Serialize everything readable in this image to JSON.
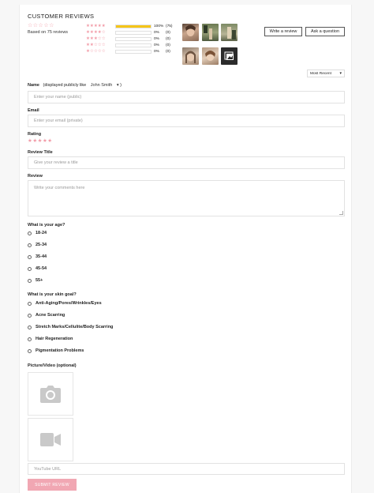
{
  "header": {
    "title": "CUSTOMER REVIEWS",
    "summary_stars": "☆☆☆☆☆",
    "based_on": "Based on 75 reviews"
  },
  "histogram": [
    {
      "stars": "★★★★★",
      "percent": 100,
      "pct_label": "100%",
      "count": "(75)"
    },
    {
      "stars": "★★★★☆",
      "percent": 0,
      "pct_label": "0%",
      "count": "(0)"
    },
    {
      "stars": "★★★☆☆",
      "percent": 0,
      "pct_label": "0%",
      "count": "(0)"
    },
    {
      "stars": "★★☆☆☆",
      "percent": 0,
      "pct_label": "0%",
      "count": "(0)"
    },
    {
      "stars": "★☆☆☆☆",
      "percent": 0,
      "pct_label": "0%",
      "count": "(0)"
    }
  ],
  "actions": {
    "write_review": "Write a review",
    "ask_question": "Ask a question"
  },
  "sort": {
    "selected": "Most Recent",
    "caret": "▾"
  },
  "form": {
    "name_label": "Name",
    "name_hint": "(displayed publicly like",
    "name_select": "John Smith",
    "name_caret": "▾",
    "name_close": ")",
    "name_placeholder": "Enter your name (public)",
    "email_label": "Email",
    "email_placeholder": "Enter your email (private)",
    "rating_label": "Rating",
    "rating_stars": "★★★★★",
    "title_label": "Review Title",
    "title_placeholder": "Give your review a title",
    "review_label": "Review",
    "review_placeholder": "Write your comments here",
    "age_label": "What is your age?",
    "age_options": [
      "18-24",
      "25-34",
      "35-44",
      "45-54",
      "55+"
    ],
    "goal_label": "What is your skin goal?",
    "goal_options": [
      "Anti-Aging/Pores/Wrinkles/Eyes",
      "Acne Scarring",
      "Stretch Marks/Cellulite/Body Scarring",
      "Hair Regeneration",
      "Pigmentation Problems"
    ],
    "media_label": "Picture/Video (optional)",
    "youtube_placeholder": "YouTube URL",
    "submit_label": "SUBMIT REVIEW"
  },
  "colors": {
    "star_pink": "#f29aa6",
    "bar_fill": "#f5c518",
    "submit_bg": "#f1a7b3"
  },
  "icons": [
    "camera-icon",
    "video-icon",
    "gallery-icon"
  ]
}
